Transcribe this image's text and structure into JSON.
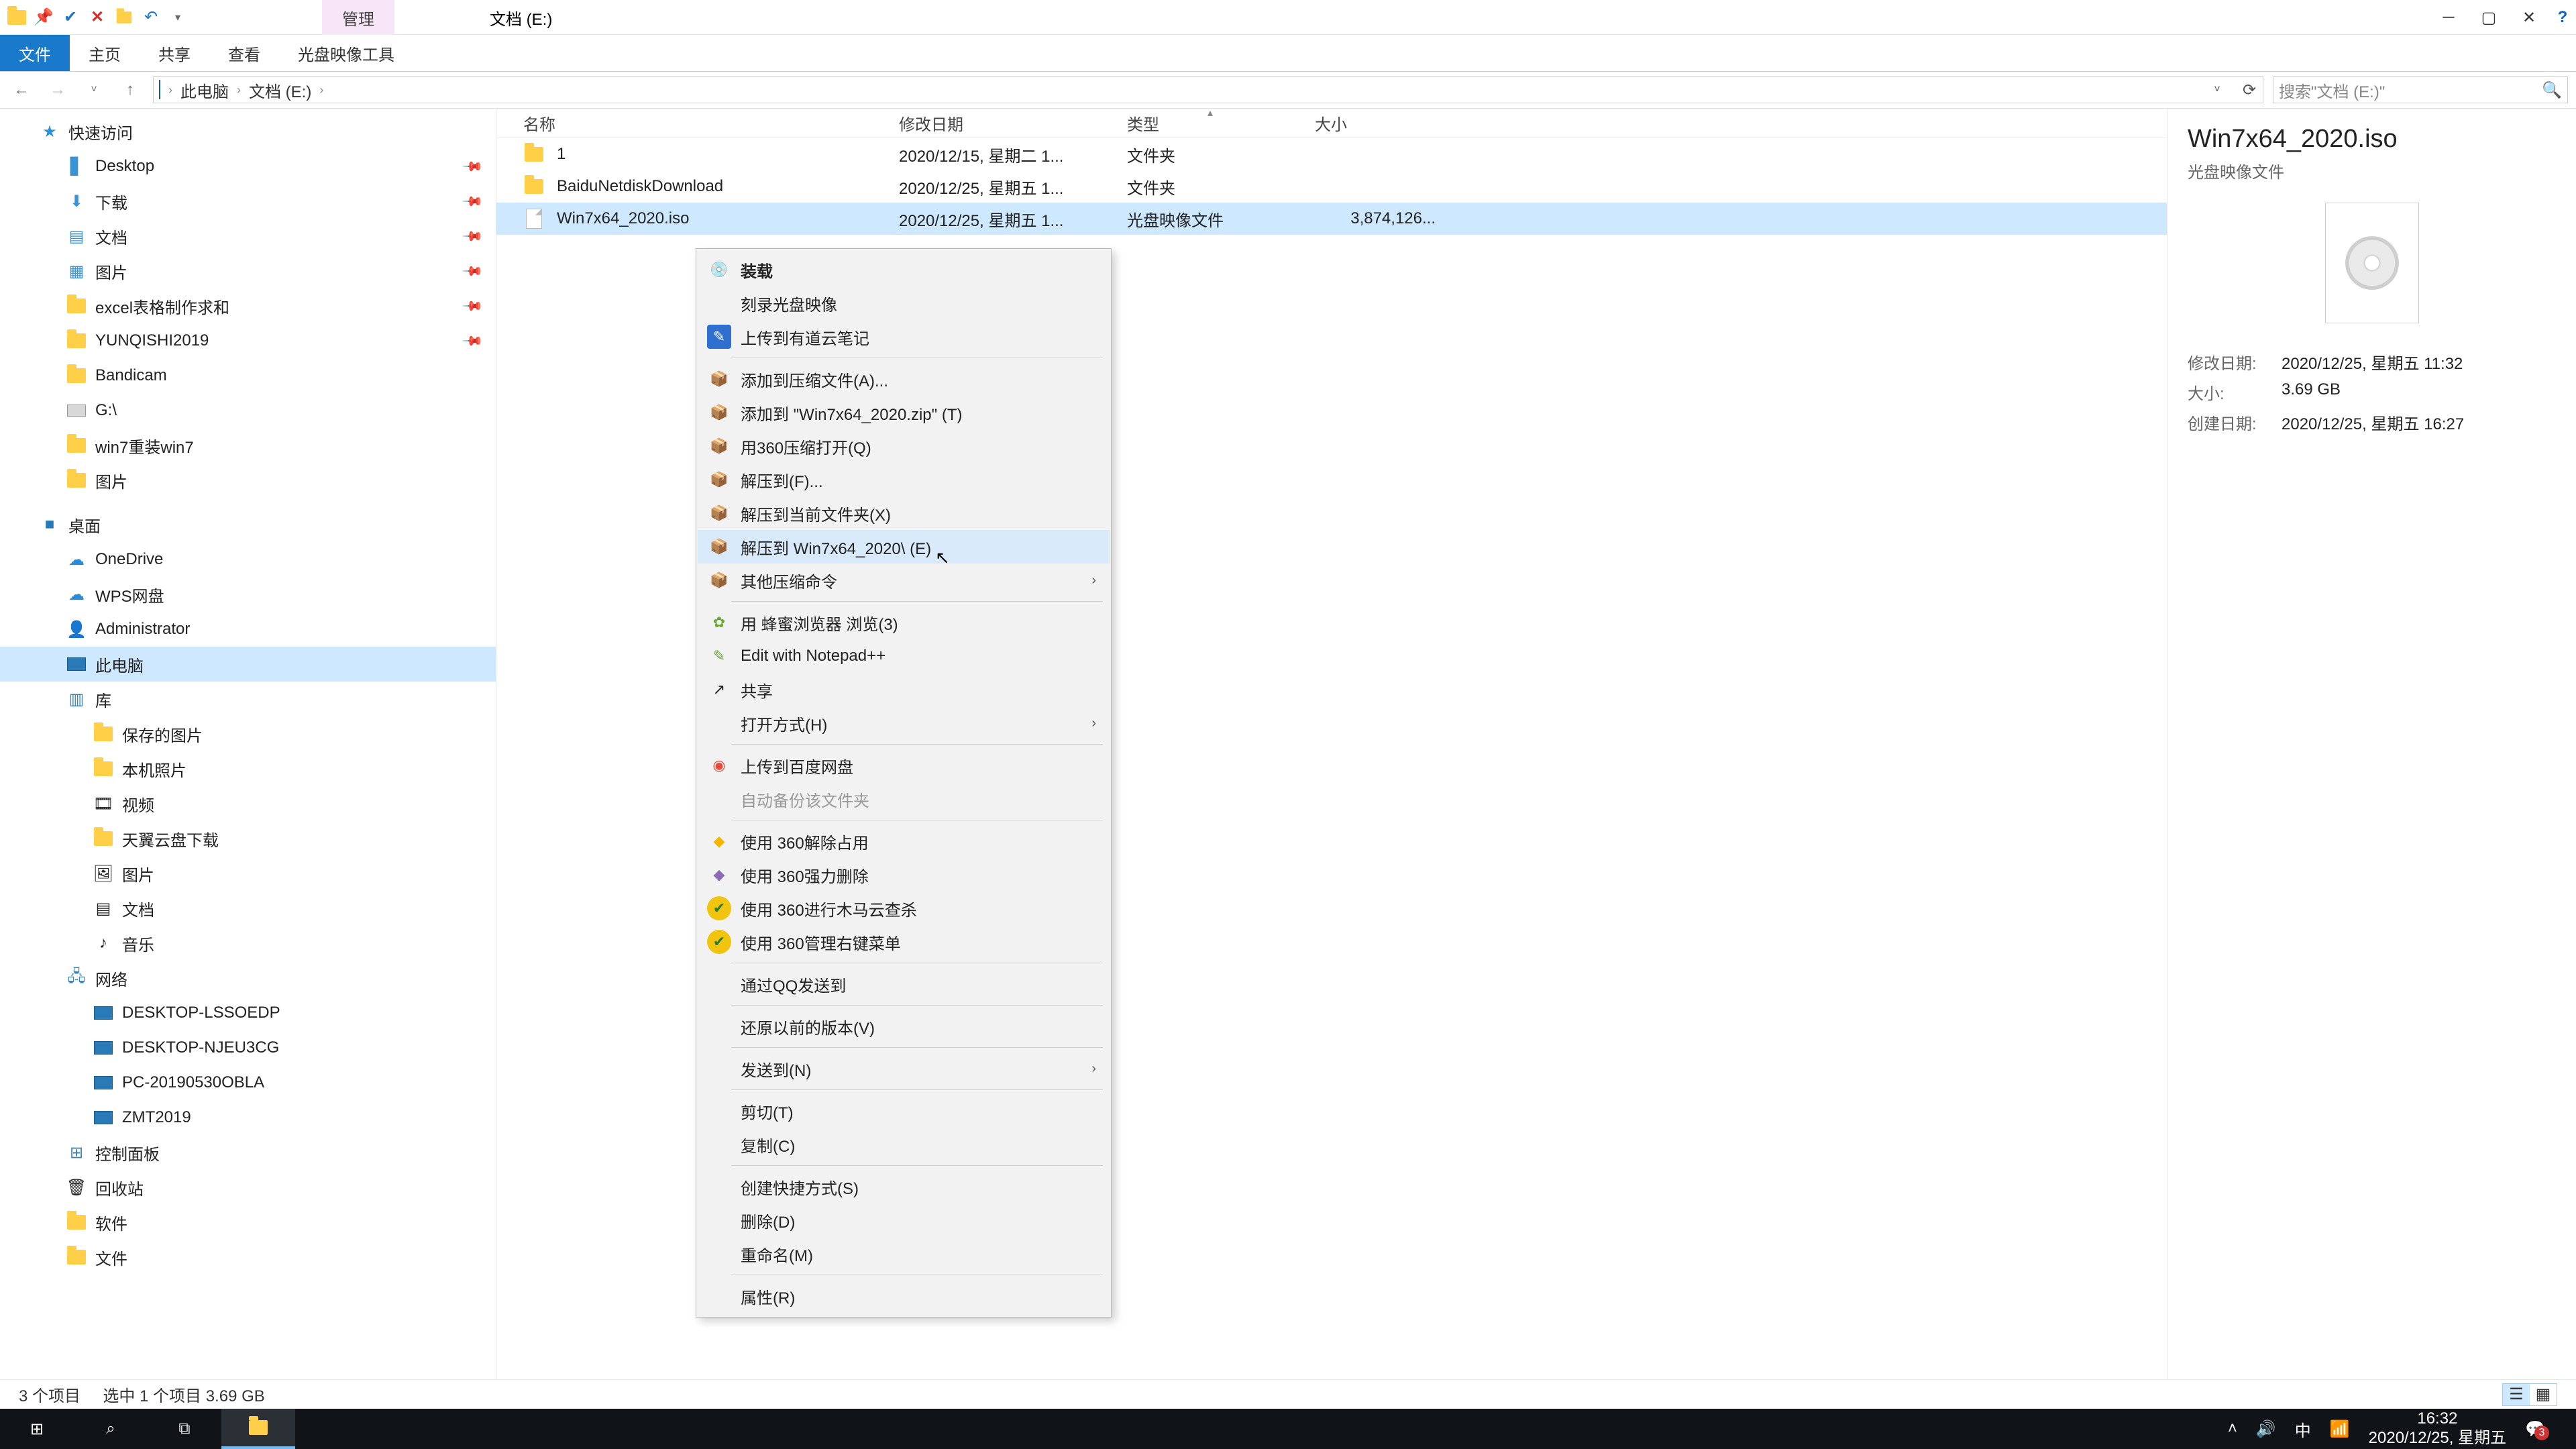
{
  "titlebar": {
    "contextual_tab": "管理",
    "window_title": "文档 (E:)"
  },
  "ribbon": {
    "file": "文件",
    "home": "主页",
    "share": "共享",
    "view": "查看",
    "disc_tools": "光盘映像工具"
  },
  "address": {
    "seg1": "此电脑",
    "seg2": "文档 (E:)",
    "search_placeholder": "搜索\"文档 (E:)\""
  },
  "nav": {
    "quick": "快速访问",
    "desktop": "Desktop",
    "downloads": "下载",
    "documents": "文档",
    "pictures": "图片",
    "excel": "excel表格制作求和",
    "yunqishi": "YUNQISHI2019",
    "bandicam": "Bandicam",
    "gdrive": "G:\\",
    "win7re": "win7重装win7",
    "pics2": "图片",
    "deskcn": "桌面",
    "onedrive": "OneDrive",
    "wps": "WPS网盘",
    "admin": "Administrator",
    "thispc": "此电脑",
    "lib": "库",
    "savedpics": "保存的图片",
    "localpics": "本机照片",
    "videos": "视频",
    "tianyi": "天翼云盘下载",
    "piclib": "图片",
    "doclib": "文档",
    "musiclib": "音乐",
    "network": "网络",
    "pc1": "DESKTOP-LSSOEDP",
    "pc2": "DESKTOP-NJEU3CG",
    "pc3": "PC-20190530OBLA",
    "pc4": "ZMT2019",
    "cpanel": "控制面板",
    "recycle": "回收站",
    "soft": "软件",
    "files": "文件"
  },
  "columns": {
    "name": "名称",
    "date": "修改日期",
    "type": "类型",
    "size": "大小"
  },
  "rows": [
    {
      "name": "1",
      "date": "2020/12/15, 星期二 1...",
      "type": "文件夹",
      "size": ""
    },
    {
      "name": "BaiduNetdiskDownload",
      "date": "2020/12/25, 星期五 1...",
      "type": "文件夹",
      "size": ""
    },
    {
      "name": "Win7x64_2020.iso",
      "date": "2020/12/25, 星期五 1...",
      "type": "光盘映像文件",
      "size": "3,874,126..."
    }
  ],
  "ctx": {
    "mount": "装载",
    "burn": "刻录光盘映像",
    "youdao": "上传到有道云笔记",
    "addarchive": "添加到压缩文件(A)...",
    "addzip": "添加到 \"Win7x64_2020.zip\" (T)",
    "open360": "用360压缩打开(Q)",
    "extractto": "解压到(F)...",
    "extracthere": "解压到当前文件夹(X)",
    "extractfolder": "解压到 Win7x64_2020\\ (E)",
    "otherzip": "其他压缩命令",
    "beebrowser": "用 蜂蜜浏览器 浏览(3)",
    "notepadpp": "Edit with Notepad++",
    "share": "共享",
    "openwith": "打开方式(H)",
    "baidupan": "上传到百度网盘",
    "autobackup": "自动备份该文件夹",
    "rel360": "使用 360解除占用",
    "del360": "使用 360强力删除",
    "scan360": "使用 360进行木马云查杀",
    "menu360": "使用 360管理右键菜单",
    "sendqq": "通过QQ发送到",
    "restore": "还原以前的版本(V)",
    "sendto": "发送到(N)",
    "cut": "剪切(T)",
    "copy": "复制(C)",
    "shortcut": "创建快捷方式(S)",
    "delete": "删除(D)",
    "rename": "重命名(M)",
    "props": "属性(R)"
  },
  "details": {
    "title": "Win7x64_2020.iso",
    "subtitle": "光盘映像文件",
    "mod_label": "修改日期:",
    "mod_val": "2020/12/25, 星期五 11:32",
    "size_label": "大小:",
    "size_val": "3.69 GB",
    "created_label": "创建日期:",
    "created_val": "2020/12/25, 星期五 16:27"
  },
  "status": {
    "count": "3 个项目",
    "sel": "选中 1 个项目  3.69 GB"
  },
  "taskbar": {
    "ime": "中",
    "time": "16:32",
    "date": "2020/12/25, 星期五"
  }
}
